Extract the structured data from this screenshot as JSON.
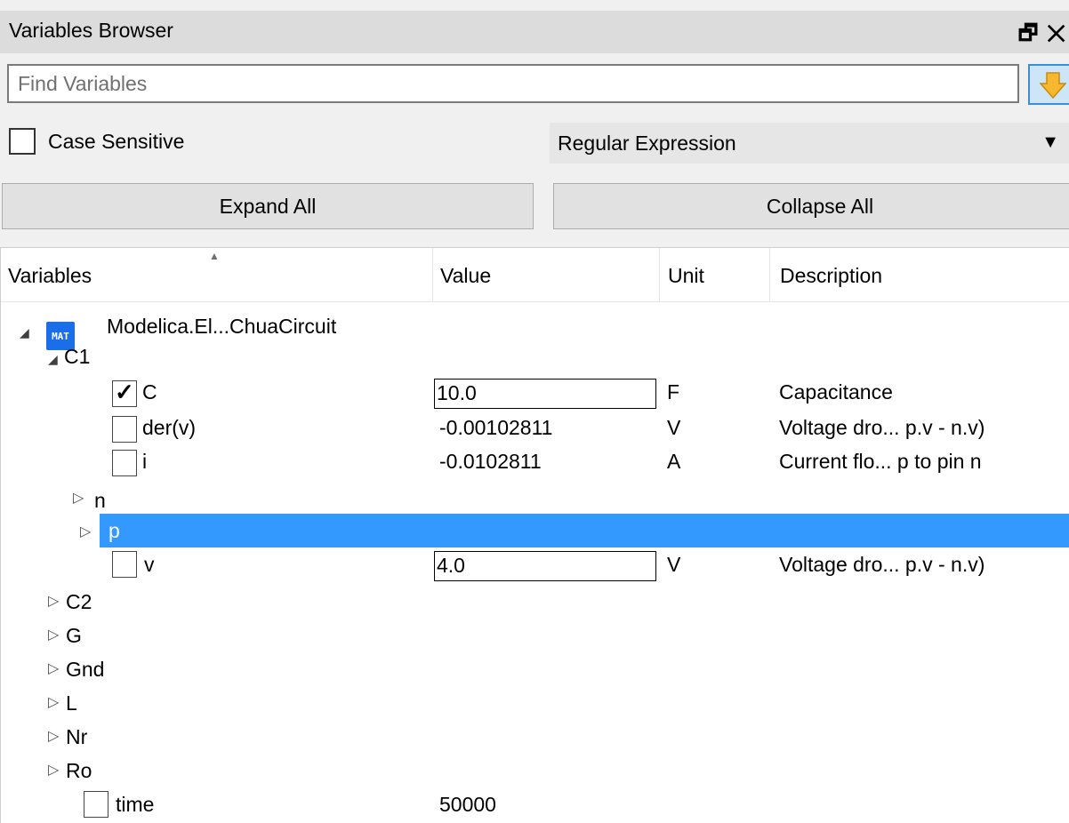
{
  "panel": {
    "title": "Variables Browser",
    "float_icon": "float-window-icon",
    "close_icon": "close-icon"
  },
  "search": {
    "placeholder": "Find Variables",
    "value": "",
    "find_icon": "down-arrow-icon"
  },
  "options": {
    "case_sensitive_label": "Case Sensitive",
    "case_sensitive_checked": false,
    "syntax_selected": "Regular Expression"
  },
  "buttons": {
    "expand_all": "Expand All",
    "collapse_all": "Collapse All"
  },
  "columns": [
    "Variables",
    "Value",
    "Unit",
    "Description"
  ],
  "tree": {
    "root": {
      "label": "Modelica.El...ChuaCircuit",
      "icon": "MAT",
      "expanded": true
    },
    "c1": {
      "label": "C1",
      "expanded": true
    },
    "c1_C": {
      "name": "C",
      "checked": true,
      "value": "10.0",
      "unit": "F",
      "description": "Capacitance"
    },
    "c1_derv": {
      "name": "der(v)",
      "checked": false,
      "value": "-0.00102811",
      "unit": "V",
      "description": "Voltage dro... p.v - n.v)"
    },
    "c1_i": {
      "name": "i",
      "checked": false,
      "value": "-0.0102811",
      "unit": "A",
      "description": "Current flo... p to pin n"
    },
    "c1_n": {
      "label": "n"
    },
    "c1_p": {
      "label": "p",
      "selected": true
    },
    "c1_v": {
      "name": "v",
      "checked": false,
      "value": "4.0",
      "unit": "V",
      "description": "Voltage dro... p.v - n.v)"
    },
    "others": [
      "C2",
      "G",
      "Gnd",
      "L",
      "Nr",
      "Ro"
    ],
    "time": {
      "name": "time",
      "checked": false,
      "value": "50000"
    }
  },
  "colors": {
    "selection": "#3399ff",
    "mat_icon": "#1a6ee8"
  }
}
